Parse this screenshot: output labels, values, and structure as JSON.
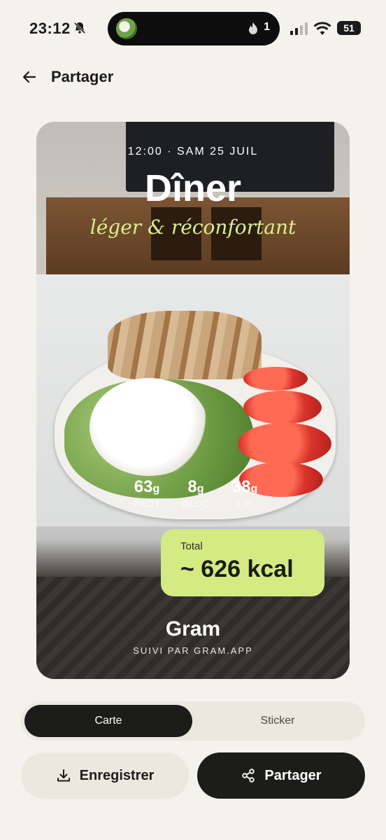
{
  "status_bar": {
    "time": "23:12",
    "notification_count": "1",
    "battery": "51"
  },
  "header": {
    "title": "Partager"
  },
  "card": {
    "time_line": "12:00 · SAM 25 JUIL",
    "meal": "Dîner",
    "subtitle": "léger & réconfortant",
    "macros": [
      {
        "value": "63",
        "unit": "g",
        "label": "PROT"
      },
      {
        "value": "8",
        "unit": "g",
        "label": "GLUC"
      },
      {
        "value": "38",
        "unit": "g",
        "label": "LIP"
      }
    ],
    "total_label": "Total",
    "total_value": "~ 626 kcal",
    "brand": "Gram",
    "brand_sub": "SUIVI PAR GRAM.APP"
  },
  "segment": {
    "active": "Carte",
    "inactive": "Sticker"
  },
  "actions": {
    "save_label": "Enregistrer",
    "share_label": "Partager"
  },
  "colors": {
    "background": "#f4f2ec",
    "accent_green": "#d4ea82",
    "dark": "#1c1c1a"
  }
}
